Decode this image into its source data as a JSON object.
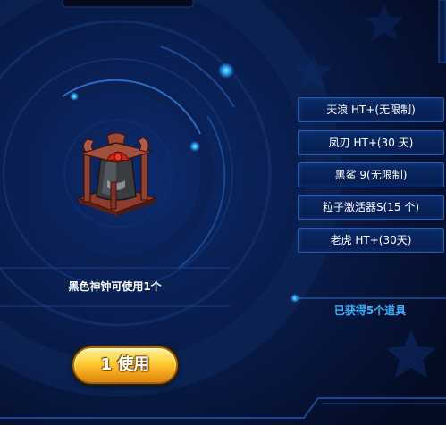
{
  "panel": {
    "item_description": "黑色神钟可使用1个",
    "obtained_text": "已获得5个道具",
    "use_button_label": "1 使用",
    "item_icon": "black-bell-icon"
  },
  "rewards": [
    {
      "label": "天浪 HT+(无限制)"
    },
    {
      "label": "凤刃 HT+(30 天)"
    },
    {
      "label": "黑鲨 9(无限制)"
    },
    {
      "label": "粒子激活器S(15 个)"
    },
    {
      "label": "老虎 HT+(30天)"
    }
  ],
  "colors": {
    "background": "#06112e",
    "accent_blue": "#3ab2ff",
    "button_gold": "#f2a51a"
  }
}
